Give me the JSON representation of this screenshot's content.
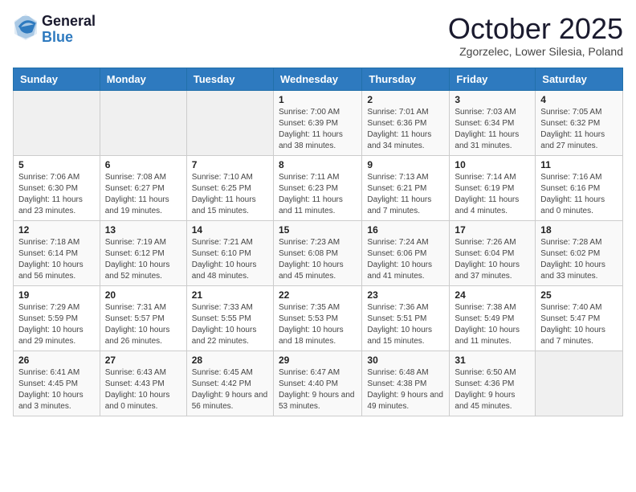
{
  "logo": {
    "general": "General",
    "blue": "Blue"
  },
  "title": "October 2025",
  "subtitle": "Zgorzelec, Lower Silesia, Poland",
  "days_of_week": [
    "Sunday",
    "Monday",
    "Tuesday",
    "Wednesday",
    "Thursday",
    "Friday",
    "Saturday"
  ],
  "weeks": [
    [
      {
        "day": "",
        "sunrise": "",
        "sunset": "",
        "daylight": ""
      },
      {
        "day": "",
        "sunrise": "",
        "sunset": "",
        "daylight": ""
      },
      {
        "day": "",
        "sunrise": "",
        "sunset": "",
        "daylight": ""
      },
      {
        "day": "1",
        "sunrise": "Sunrise: 7:00 AM",
        "sunset": "Sunset: 6:39 PM",
        "daylight": "Daylight: 11 hours and 38 minutes."
      },
      {
        "day": "2",
        "sunrise": "Sunrise: 7:01 AM",
        "sunset": "Sunset: 6:36 PM",
        "daylight": "Daylight: 11 hours and 34 minutes."
      },
      {
        "day": "3",
        "sunrise": "Sunrise: 7:03 AM",
        "sunset": "Sunset: 6:34 PM",
        "daylight": "Daylight: 11 hours and 31 minutes."
      },
      {
        "day": "4",
        "sunrise": "Sunrise: 7:05 AM",
        "sunset": "Sunset: 6:32 PM",
        "daylight": "Daylight: 11 hours and 27 minutes."
      }
    ],
    [
      {
        "day": "5",
        "sunrise": "Sunrise: 7:06 AM",
        "sunset": "Sunset: 6:30 PM",
        "daylight": "Daylight: 11 hours and 23 minutes."
      },
      {
        "day": "6",
        "sunrise": "Sunrise: 7:08 AM",
        "sunset": "Sunset: 6:27 PM",
        "daylight": "Daylight: 11 hours and 19 minutes."
      },
      {
        "day": "7",
        "sunrise": "Sunrise: 7:10 AM",
        "sunset": "Sunset: 6:25 PM",
        "daylight": "Daylight: 11 hours and 15 minutes."
      },
      {
        "day": "8",
        "sunrise": "Sunrise: 7:11 AM",
        "sunset": "Sunset: 6:23 PM",
        "daylight": "Daylight: 11 hours and 11 minutes."
      },
      {
        "day": "9",
        "sunrise": "Sunrise: 7:13 AM",
        "sunset": "Sunset: 6:21 PM",
        "daylight": "Daylight: 11 hours and 7 minutes."
      },
      {
        "day": "10",
        "sunrise": "Sunrise: 7:14 AM",
        "sunset": "Sunset: 6:19 PM",
        "daylight": "Daylight: 11 hours and 4 minutes."
      },
      {
        "day": "11",
        "sunrise": "Sunrise: 7:16 AM",
        "sunset": "Sunset: 6:16 PM",
        "daylight": "Daylight: 11 hours and 0 minutes."
      }
    ],
    [
      {
        "day": "12",
        "sunrise": "Sunrise: 7:18 AM",
        "sunset": "Sunset: 6:14 PM",
        "daylight": "Daylight: 10 hours and 56 minutes."
      },
      {
        "day": "13",
        "sunrise": "Sunrise: 7:19 AM",
        "sunset": "Sunset: 6:12 PM",
        "daylight": "Daylight: 10 hours and 52 minutes."
      },
      {
        "day": "14",
        "sunrise": "Sunrise: 7:21 AM",
        "sunset": "Sunset: 6:10 PM",
        "daylight": "Daylight: 10 hours and 48 minutes."
      },
      {
        "day": "15",
        "sunrise": "Sunrise: 7:23 AM",
        "sunset": "Sunset: 6:08 PM",
        "daylight": "Daylight: 10 hours and 45 minutes."
      },
      {
        "day": "16",
        "sunrise": "Sunrise: 7:24 AM",
        "sunset": "Sunset: 6:06 PM",
        "daylight": "Daylight: 10 hours and 41 minutes."
      },
      {
        "day": "17",
        "sunrise": "Sunrise: 7:26 AM",
        "sunset": "Sunset: 6:04 PM",
        "daylight": "Daylight: 10 hours and 37 minutes."
      },
      {
        "day": "18",
        "sunrise": "Sunrise: 7:28 AM",
        "sunset": "Sunset: 6:02 PM",
        "daylight": "Daylight: 10 hours and 33 minutes."
      }
    ],
    [
      {
        "day": "19",
        "sunrise": "Sunrise: 7:29 AM",
        "sunset": "Sunset: 5:59 PM",
        "daylight": "Daylight: 10 hours and 29 minutes."
      },
      {
        "day": "20",
        "sunrise": "Sunrise: 7:31 AM",
        "sunset": "Sunset: 5:57 PM",
        "daylight": "Daylight: 10 hours and 26 minutes."
      },
      {
        "day": "21",
        "sunrise": "Sunrise: 7:33 AM",
        "sunset": "Sunset: 5:55 PM",
        "daylight": "Daylight: 10 hours and 22 minutes."
      },
      {
        "day": "22",
        "sunrise": "Sunrise: 7:35 AM",
        "sunset": "Sunset: 5:53 PM",
        "daylight": "Daylight: 10 hours and 18 minutes."
      },
      {
        "day": "23",
        "sunrise": "Sunrise: 7:36 AM",
        "sunset": "Sunset: 5:51 PM",
        "daylight": "Daylight: 10 hours and 15 minutes."
      },
      {
        "day": "24",
        "sunrise": "Sunrise: 7:38 AM",
        "sunset": "Sunset: 5:49 PM",
        "daylight": "Daylight: 10 hours and 11 minutes."
      },
      {
        "day": "25",
        "sunrise": "Sunrise: 7:40 AM",
        "sunset": "Sunset: 5:47 PM",
        "daylight": "Daylight: 10 hours and 7 minutes."
      }
    ],
    [
      {
        "day": "26",
        "sunrise": "Sunrise: 6:41 AM",
        "sunset": "Sunset: 4:45 PM",
        "daylight": "Daylight: 10 hours and 3 minutes."
      },
      {
        "day": "27",
        "sunrise": "Sunrise: 6:43 AM",
        "sunset": "Sunset: 4:43 PM",
        "daylight": "Daylight: 10 hours and 0 minutes."
      },
      {
        "day": "28",
        "sunrise": "Sunrise: 6:45 AM",
        "sunset": "Sunset: 4:42 PM",
        "daylight": "Daylight: 9 hours and 56 minutes."
      },
      {
        "day": "29",
        "sunrise": "Sunrise: 6:47 AM",
        "sunset": "Sunset: 4:40 PM",
        "daylight": "Daylight: 9 hours and 53 minutes."
      },
      {
        "day": "30",
        "sunrise": "Sunrise: 6:48 AM",
        "sunset": "Sunset: 4:38 PM",
        "daylight": "Daylight: 9 hours and 49 minutes."
      },
      {
        "day": "31",
        "sunrise": "Sunrise: 6:50 AM",
        "sunset": "Sunset: 4:36 PM",
        "daylight": "Daylight: 9 hours and 45 minutes."
      },
      {
        "day": "",
        "sunrise": "",
        "sunset": "",
        "daylight": ""
      }
    ]
  ]
}
